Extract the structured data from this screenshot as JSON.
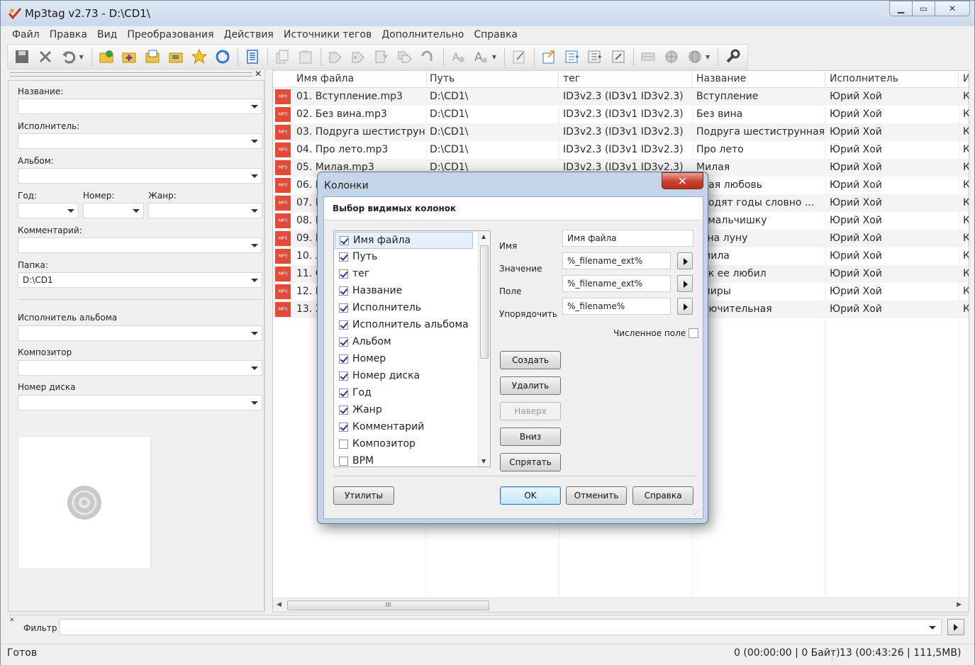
{
  "app": {
    "title": "Mp3tag v2.73  -  D:\\CD1\\",
    "window_buttons": [
      "minimize",
      "maximize",
      "close"
    ]
  },
  "menu": [
    "Файл",
    "Правка",
    "Вид",
    "Преобразования",
    "Действия",
    "Источники тегов",
    "Дополнительно",
    "Справка"
  ],
  "toolbar": {
    "icons": [
      "save-icon",
      "remove-tag-icon",
      "undo-icon",
      "change-dir-icon",
      "add-dir-icon",
      "open-file-icon",
      "playlist-icon",
      "favorite-star-icon",
      "refresh-icon",
      "extended-tags-icon",
      "copy-tag-icon",
      "paste-tag-icon",
      "tag-filename-icon",
      "filename-tag-icon",
      "text-file-tag-icon",
      "tag-tag-icon",
      "filename-filename-icon",
      "autonumber-icon",
      "case-conversion-icon",
      "edit-icon",
      "export-icon",
      "import-icon",
      "quick-action-icon",
      "actions-icon",
      "freedb-icon",
      "web-source-icon",
      "web-source-2-icon",
      "options-icon"
    ]
  },
  "tag_panel": {
    "fields": {
      "title_label": "Название:",
      "artist_label": "Исполнитель:",
      "album_label": "Альбом:",
      "year_label": "Год:",
      "track_label": "Номер:",
      "genre_label": "Жанр:",
      "comment_label": "Комментарий:",
      "folder_label": "Папка:",
      "folder_value": "D:\\CD1",
      "album_artist_label": "Исполнитель альбома",
      "composer_label": "Композитор",
      "disc_label": "Номер диска"
    }
  },
  "file_list": {
    "columns": [
      "Имя файла",
      "Путь",
      "тег",
      "Название",
      "Исполнитель",
      "И"
    ],
    "file_icon_label": "MP3",
    "rows": [
      {
        "file": "01. Вступление.mp3",
        "path": "D:\\CD1\\",
        "tag": "ID3v2.3 (ID3v1 ID3v2.3)",
        "title": "Вступление",
        "artist": "Юрий Хой",
        "extra": "К"
      },
      {
        "file": "02. Без вина.mp3",
        "path": "D:\\CD1\\",
        "tag": "ID3v2.3 (ID3v1 ID3v2.3)",
        "title": "Без вина",
        "artist": "Юрий Хой",
        "extra": "К"
      },
      {
        "file": "03. Подруга шестиструн...",
        "path": "D:\\CD1\\",
        "tag": "ID3v2.3 (ID3v1 ID3v2.3)",
        "title": "Подруга шестиструнная",
        "artist": "Юрий Хой",
        "extra": "К"
      },
      {
        "file": "04. Про лето.mp3",
        "path": "D:\\CD1\\",
        "tag": "ID3v2.3 (ID3v1 ID3v2.3)",
        "title": "Про лето",
        "artist": "Юрий Хой",
        "extra": "К"
      },
      {
        "file": "05. Милая.mp3",
        "path": "D:\\CD1\\",
        "tag": "ID3v2.3 (ID3v1 ID3v2.3)",
        "title": "Милая",
        "artist": "Юрий Хой",
        "extra": "К"
      },
      {
        "file": "06. П",
        "path": "",
        "tag": "",
        "title": "рвая любовь",
        "artist": "Юрий Хой",
        "extra": "К"
      },
      {
        "file": "07. П",
        "path": "",
        "tag": "",
        "title": "оходят годы словно ...",
        "artist": "Юрий Хой",
        "extra": "К"
      },
      {
        "file": "08. П",
        "path": "",
        "tag": "",
        "title": "ю мальчишку",
        "artist": "Юрий Хой",
        "extra": "К"
      },
      {
        "file": "09. В",
        "path": "",
        "tag": "",
        "title": "ы на луну",
        "artist": "Юрий Хой",
        "extra": "К"
      },
      {
        "file": "10. Л",
        "path": "",
        "tag": "",
        "title": "дмила",
        "artist": "Юрий Хой",
        "extra": "К"
      },
      {
        "file": "11. С",
        "path": "",
        "tag": "",
        "title": "так ее любил",
        "artist": "Юрий Хой",
        "extra": "К"
      },
      {
        "file": "12. В",
        "path": "",
        "tag": "",
        "title": "мпиры",
        "artist": "Юрий Хой",
        "extra": "К"
      },
      {
        "file": "13. З",
        "path": "",
        "tag": "",
        "title": "ключительная",
        "artist": "Юрий Хой",
        "extra": "К"
      }
    ],
    "scroll_grip": "III"
  },
  "filter": {
    "label": "Фильтр",
    "value": ""
  },
  "status": {
    "left": "Готов",
    "selected": "0 (00:00:00 | 0 Байт)",
    "total": "13 (00:43:26 | 111,5MB)"
  },
  "dialog": {
    "title": "Колонки",
    "close_glyph": "✕",
    "header": "Выбор видимых колонок",
    "columns": [
      {
        "label": "Имя файла",
        "checked": true,
        "selected": true
      },
      {
        "label": "Путь",
        "checked": true
      },
      {
        "label": "тег",
        "checked": true
      },
      {
        "label": "Название",
        "checked": true
      },
      {
        "label": "Исполнитель",
        "checked": true
      },
      {
        "label": "Исполнитель альбома",
        "checked": true
      },
      {
        "label": "Альбом",
        "checked": true
      },
      {
        "label": "Номер",
        "checked": true
      },
      {
        "label": "Номер диска",
        "checked": true
      },
      {
        "label": "Год",
        "checked": true
      },
      {
        "label": "Жанр",
        "checked": true
      },
      {
        "label": "Комментарий",
        "checked": true
      },
      {
        "label": "Композитор",
        "checked": false
      },
      {
        "label": "BPM",
        "checked": false
      }
    ],
    "fields": {
      "name_label": "Имя",
      "name_value": "Имя файла",
      "value_label": "Значение",
      "value_value": "%_filename_ext%",
      "field_label": "Поле",
      "field_value": "%_filename_ext%",
      "sort_label": "Упорядочить",
      "sort_value": "%_filename%",
      "numeric_label": "Численное поле",
      "numeric_checked": false
    },
    "buttons": {
      "create": "Создать",
      "delete": "Удалить",
      "up": "Наверх",
      "down": "Вниз",
      "hide": "Спрятать",
      "utils": "Утилиты",
      "ok": "OK",
      "cancel": "Отменить",
      "help": "Справка"
    }
  },
  "colors": {
    "mp3_badge": "#e34a3a",
    "close_button": "#c9412c",
    "dialog_frame": "#c4d5e9"
  }
}
